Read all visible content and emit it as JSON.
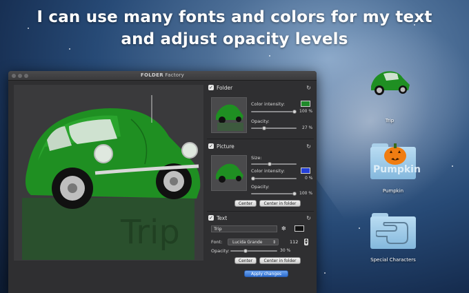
{
  "headline": {
    "line1": "I can use many fonts and colors for my text",
    "line2": "and adjust opacity levels"
  },
  "window": {
    "title_bold": "FOLDER",
    "title_rest": "Factory"
  },
  "canvas": {
    "folder_label": "Trip"
  },
  "folder_section": {
    "title": "Folder",
    "checked": true,
    "color_intensity_label": "Color intensity:",
    "color_intensity_value": "100 %",
    "color_intensity_fraction": 1.0,
    "color_swatch": "#1f8a2a",
    "opacity_label": "Opacity:",
    "opacity_value": "27 %",
    "opacity_fraction": 0.27
  },
  "picture_section": {
    "title": "Picture",
    "checked": true,
    "size_label": "Size:",
    "size_fraction": 0.4,
    "color_intensity_label": "Color intensity:",
    "color_intensity_value": "0 %",
    "color_intensity_fraction": 0.0,
    "color_swatch": "#2440d8",
    "opacity_label": "Opacity:",
    "opacity_value": "100 %",
    "opacity_fraction": 1.0,
    "center_label": "Center",
    "center_in_folder_label": "Center in folder"
  },
  "text_section": {
    "title": "Text",
    "checked": true,
    "text_value": "Trip",
    "color_swatch": "#111111",
    "font_label": "Font:",
    "font_value": "Lucida Grande",
    "font_size": "112",
    "opacity_label": "Opacity:",
    "opacity_value": "30 %",
    "opacity_fraction": 0.3,
    "center_label": "Center",
    "center_in_folder_label": "Center in folder"
  },
  "apply_label": "Apply changes",
  "desktop_icons": [
    {
      "label": "Trip",
      "icon": "car-folder-icon"
    },
    {
      "label": "Pumpkin",
      "icon": "pumpkin-folder-icon",
      "folder_word": "Pumpkin"
    },
    {
      "label": "Special Characters",
      "icon": "hand-folder-icon"
    }
  ],
  "colors": {
    "car_green": "#1f8f22",
    "panel_bg": "#2f2f31",
    "apply_blue": "#3b7ddc"
  }
}
